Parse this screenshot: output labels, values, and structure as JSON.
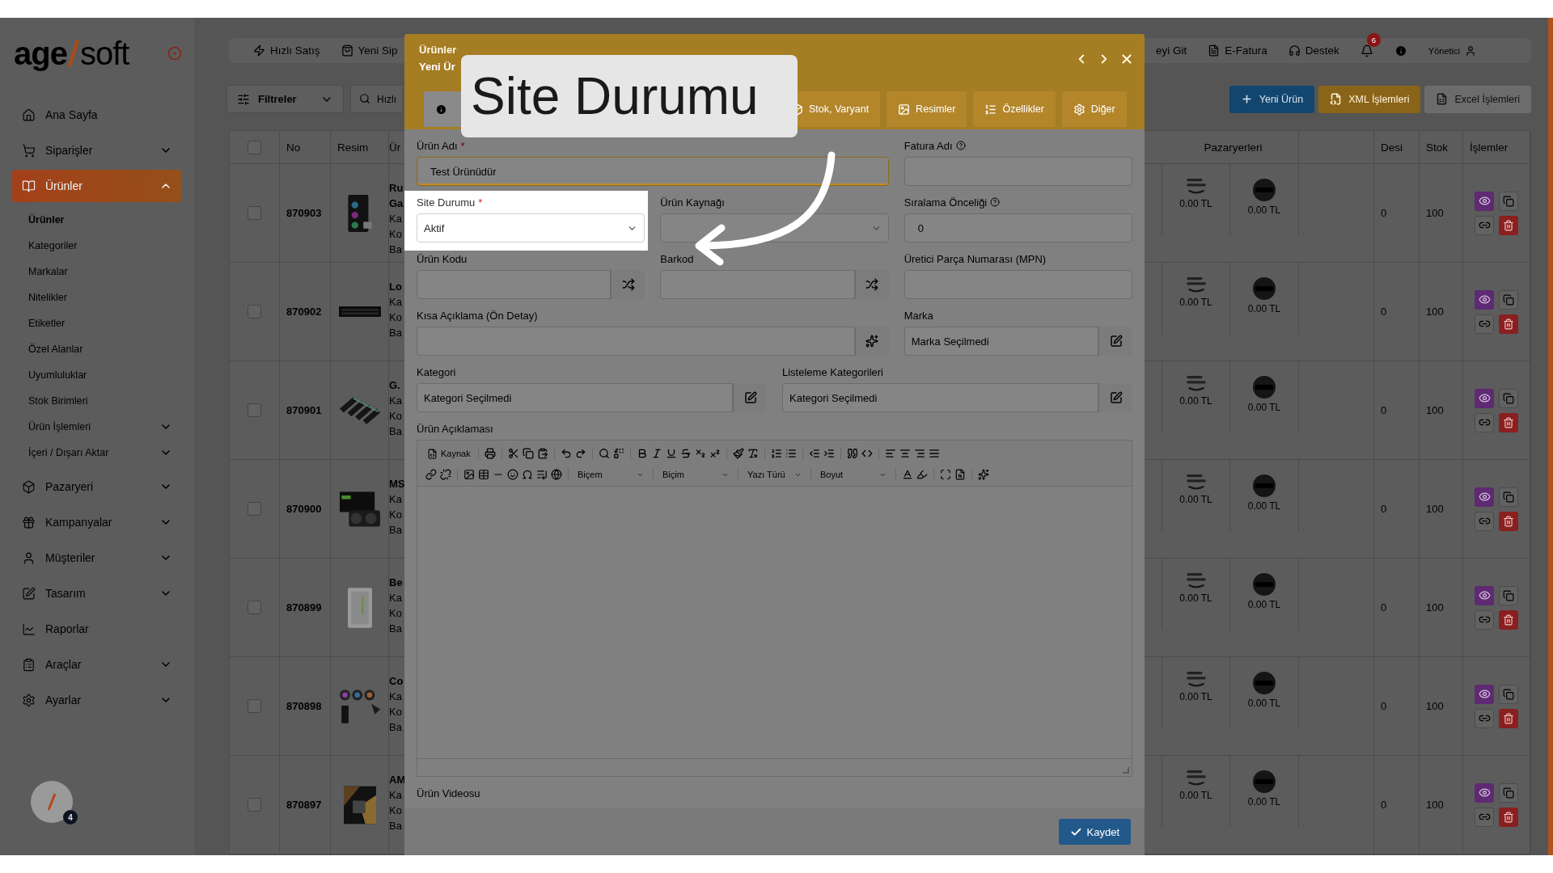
{
  "sidebar": {
    "logo": {
      "left": "age",
      "right": "soft"
    },
    "items": [
      {
        "label": "Ana Sayfa",
        "selected": false
      },
      {
        "label": "Siparişler",
        "selected": false,
        "expanded": false
      },
      {
        "label": "Ürünler",
        "selected": true,
        "expanded": true,
        "children": [
          {
            "label": "Ürünler",
            "selected": true
          },
          {
            "label": "Kategoriler",
            "selected": false
          },
          {
            "label": "Markalar",
            "selected": false
          },
          {
            "label": "Nitelikler",
            "selected": false
          },
          {
            "label": "Etiketler",
            "selected": false
          },
          {
            "label": "Özel Alanlar",
            "selected": false
          },
          {
            "label": "Uyumluluklar",
            "selected": false
          },
          {
            "label": "Stok Birimleri",
            "selected": false
          },
          {
            "label": "Ürün İşlemleri",
            "selected": false,
            "expanded": false
          },
          {
            "label": "İçeri / Dışarı Aktar",
            "selected": false,
            "expanded": false
          }
        ]
      },
      {
        "label": "Pazaryeri",
        "selected": false,
        "expanded": false
      },
      {
        "label": "Kampanyalar",
        "selected": false,
        "expanded": false
      },
      {
        "label": "Müşteriler",
        "selected": false,
        "expanded": false
      },
      {
        "label": "Tasarım",
        "selected": false,
        "expanded": false
      },
      {
        "label": "Raporlar",
        "selected": false
      },
      {
        "label": "Araçlar",
        "selected": false,
        "expanded": false
      },
      {
        "label": "Ayarlar",
        "selected": false,
        "expanded": false
      }
    ],
    "user_badge": "4"
  },
  "top_bar": {
    "left": [
      {
        "label": "Hızlı Satış"
      },
      {
        "label": "Yeni Sip"
      }
    ],
    "right": [
      {
        "label": "eyi Git"
      },
      {
        "label": "E-Fatura"
      },
      {
        "label": "Destek"
      }
    ],
    "notification_count": "6",
    "user": "Yönetici"
  },
  "toolbar": {
    "filter": "Filtreler",
    "search": {
      "placeholder": "Hızlı"
    },
    "buttons": [
      {
        "label": "Yeni Ürün",
        "kind": "primary"
      },
      {
        "label": "XML İşlemleri",
        "kind": "warning"
      },
      {
        "label": "Excel İşlemleri",
        "kind": "secondary"
      }
    ]
  },
  "table": {
    "select_all": {
      "checked": false
    },
    "columns": [
      "No",
      "Resim",
      "Ür",
      "Pazaryerleri",
      "Desi",
      "Stok",
      "İşlemler"
    ],
    "rows": [
      {
        "checked": false,
        "no": "870903",
        "name_lines": [
          "Ru",
          "Ga"
        ],
        "detail_lines": [
          "Ka",
          "Ko",
          "Ba"
        ],
        "image": {
          "kind": "picture"
        },
        "marketplaces": [
          {
            "kind": "wordmark",
            "price": "0.00 TL"
          },
          {
            "kind": "round",
            "price": "0.00 TL"
          }
        ],
        "desi": "0",
        "stock": "100"
      },
      {
        "checked": false,
        "no": "870902",
        "name_lines": [
          "Lo"
        ],
        "detail_lines": [
          "Ka",
          "Ko",
          "Ba"
        ],
        "image": {
          "kind": "picture"
        },
        "marketplaces": [
          {
            "kind": "wordmark",
            "price": "0.00 TL"
          },
          {
            "kind": "round",
            "price": "0.00 TL"
          }
        ],
        "desi": "0",
        "stock": "100"
      },
      {
        "checked": false,
        "no": "870901",
        "name_lines": [
          "G."
        ],
        "detail_lines": [
          "Ka",
          "Ko",
          "Ba"
        ],
        "image": {
          "kind": "picture"
        },
        "marketplaces": [
          {
            "kind": "wordmark",
            "price": "0.00 TL"
          },
          {
            "kind": "round",
            "price": "0.00 TL"
          }
        ],
        "desi": "0",
        "stock": "100"
      },
      {
        "checked": false,
        "no": "870900",
        "name_lines": [
          "MS"
        ],
        "detail_lines": [
          "Ka",
          "Ko",
          "Ba"
        ],
        "image": {
          "kind": "picture"
        },
        "marketplaces": [
          {
            "kind": "wordmark",
            "price": "0.00 TL"
          },
          {
            "kind": "round",
            "price": "0.00 TL"
          }
        ],
        "desi": "0",
        "stock": "100"
      },
      {
        "checked": false,
        "no": "870899",
        "name_lines": [
          "Be"
        ],
        "detail_lines": [
          "Ka",
          "Ko",
          "Ba"
        ],
        "image": {
          "kind": "picture"
        },
        "marketplaces": [
          {
            "kind": "wordmark",
            "price": "0.00 TL"
          },
          {
            "kind": "round",
            "price": "0.00 TL"
          }
        ],
        "desi": "0",
        "stock": "100"
      },
      {
        "checked": false,
        "no": "870898",
        "name_lines": [
          "Co"
        ],
        "detail_lines": [
          "Ka",
          "Ko",
          "Ba"
        ],
        "image": {
          "kind": "picture"
        },
        "marketplaces": [
          {
            "kind": "wordmark",
            "price": "0.00 TL"
          },
          {
            "kind": "round",
            "price": "0.00 TL"
          }
        ],
        "desi": "0",
        "stock": "100"
      },
      {
        "checked": false,
        "no": "870897",
        "name_lines": [
          "AM"
        ],
        "detail_lines": [
          "Ka",
          "Ko",
          "Ba"
        ],
        "image": {
          "kind": "picture"
        },
        "marketplaces": [
          {
            "kind": "wordmark",
            "price": "0.00 TL"
          },
          {
            "kind": "round",
            "price": "0.00 TL"
          }
        ],
        "desi": "0",
        "stock": "100"
      }
    ]
  },
  "modal": {
    "breadcrumb": "Ürünler",
    "title": "Yeni Ür",
    "tabs": [
      {
        "selected": true
      },
      {
        "label": "Stok, Varyant",
        "selected": false
      },
      {
        "label": "Resimler",
        "selected": false
      },
      {
        "label": "Özellikler",
        "selected": false
      },
      {
        "label": "Diğer",
        "selected": false
      }
    ],
    "rows": [
      [
        {
          "label": "Ürün Adı",
          "required_mark": "*",
          "kind": "input",
          "value": "Test Ürünüdür",
          "focused": true
        },
        {
          "label": "Fatura Adı",
          "help": true,
          "kind": "input"
        }
      ],
      [
        {
          "label": "Site Durumu",
          "required_mark": "*",
          "kind": "select",
          "value": "Aktif",
          "highlighted": true
        },
        {
          "label": "Ürün Kaynağı",
          "kind": "select"
        },
        {
          "label": "Sıralama Önceliği",
          "help": true,
          "kind": "input",
          "value": "0"
        }
      ],
      [
        {
          "label": "Ürün Kodu",
          "kind": "random"
        },
        {
          "label": "Barkod",
          "kind": "random"
        },
        {
          "label": "Üretici Parça Numarası (MPN)",
          "kind": "input"
        }
      ],
      [
        {
          "label": "Kısa Açıklama (Ön Detay)",
          "kind": "ai"
        },
        {
          "label": "Marka",
          "kind": "picker",
          "value": "Marka Seçilmedi"
        }
      ],
      [
        {
          "label": "Kategori",
          "kind": "picker",
          "value": "Kategori Seçilmedi"
        },
        {
          "label": "Listeleme Kategorileri",
          "kind": "picker",
          "value": "Kategori Seçilmedi"
        }
      ]
    ],
    "editor": {
      "label": "Ürün Açıklaması",
      "source_button": "Kaynak",
      "dropdowns": [
        "Biçem",
        "Biçim",
        "Yazı Türü",
        "Boyut"
      ]
    },
    "video_label": "Ürün Videosu",
    "save_button": "Kaydet"
  },
  "callout": {
    "text": "Site Durumu"
  }
}
